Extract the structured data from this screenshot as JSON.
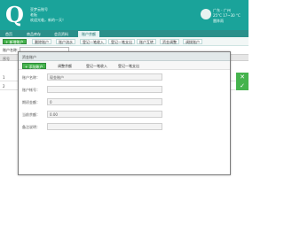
{
  "header": {
    "logo_letter": "Q",
    "lines": [
      "亚梦云账号",
      "老板",
      "欢迎光临，新的一天！"
    ],
    "weather": {
      "city": "广东 · 广州",
      "temp": "25°C 17~30 °C",
      "condition": "雷阵雨"
    }
  },
  "nav": {
    "tabs": [
      {
        "label": "首页",
        "active": false
      },
      {
        "label": "商品库存",
        "active": false
      },
      {
        "label": "会员资料",
        "active": false
      },
      {
        "label": "账户余额",
        "active": true
      }
    ]
  },
  "toolbar": {
    "add_account": "+ 新增账户",
    "buttons": [
      "删除账户",
      "账户流水",
      "登记一笔收入",
      "登记一笔支出",
      "账户互转",
      "资金调整",
      "调拨账户"
    ]
  },
  "filter": {
    "label": "账户名称：",
    "value": ""
  },
  "grid": {
    "header": "序号",
    "rows": [
      "1",
      "2"
    ]
  },
  "modal": {
    "title": "资金账户",
    "tool": [
      "+ 添加账户",
      "调整余额",
      "登记一笔收入",
      "登记一笔支出"
    ],
    "fields": [
      {
        "label": "账户名称：",
        "value": "现金账户"
      },
      {
        "label": "账户帐号：",
        "value": ""
      },
      {
        "label": "期初金额：",
        "value": "0"
      },
      {
        "label": "当前余额：",
        "value": "0.00"
      },
      {
        "label": "备注说明：",
        "value": ""
      }
    ]
  },
  "colors": {
    "brand": "#1aa39a",
    "nav": "#2a8f8a",
    "green": "#45b34d"
  }
}
